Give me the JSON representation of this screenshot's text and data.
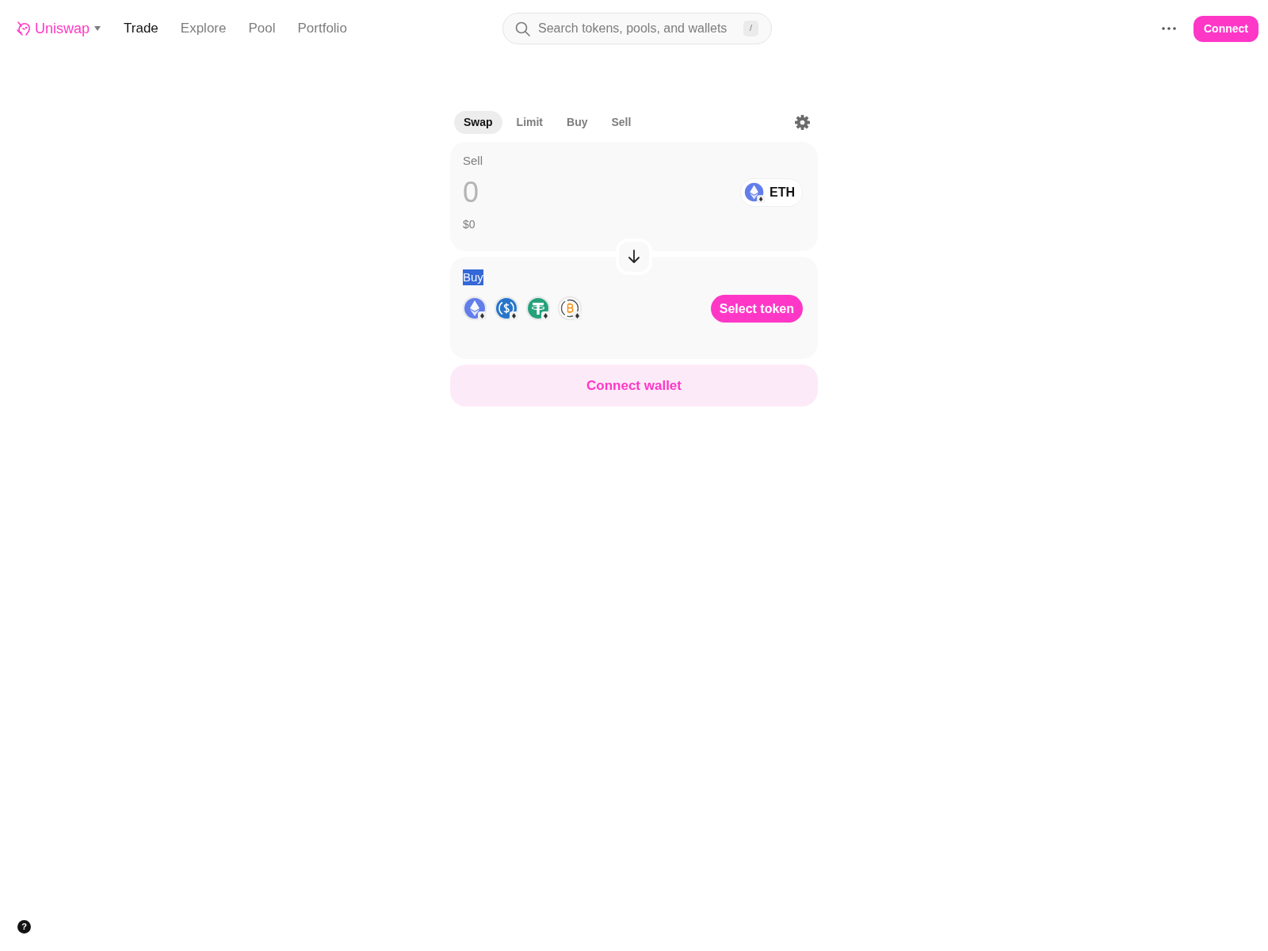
{
  "header": {
    "brand": "Uniswap",
    "nav": [
      {
        "label": "Trade",
        "selected": true
      },
      {
        "label": "Explore",
        "selected": false
      },
      {
        "label": "Pool",
        "selected": false
      },
      {
        "label": "Portfolio",
        "selected": false
      }
    ],
    "search": {
      "placeholder": "Search tokens, pools, and wallets",
      "shortcut": "/"
    },
    "connect_button": "Connect"
  },
  "swap": {
    "tabs": [
      {
        "label": "Swap",
        "selected": true
      },
      {
        "label": "Limit",
        "selected": false
      },
      {
        "label": "Buy",
        "selected": false
      },
      {
        "label": "Sell",
        "selected": false
      }
    ],
    "sell": {
      "label": "Sell",
      "amount_placeholder": "0",
      "usd_value": "$0",
      "token": "ETH"
    },
    "buy": {
      "label": "Buy",
      "label_highlighted": true,
      "select_button": "Select token"
    },
    "connect_wallet": "Connect wallet"
  },
  "help_button": "?"
}
